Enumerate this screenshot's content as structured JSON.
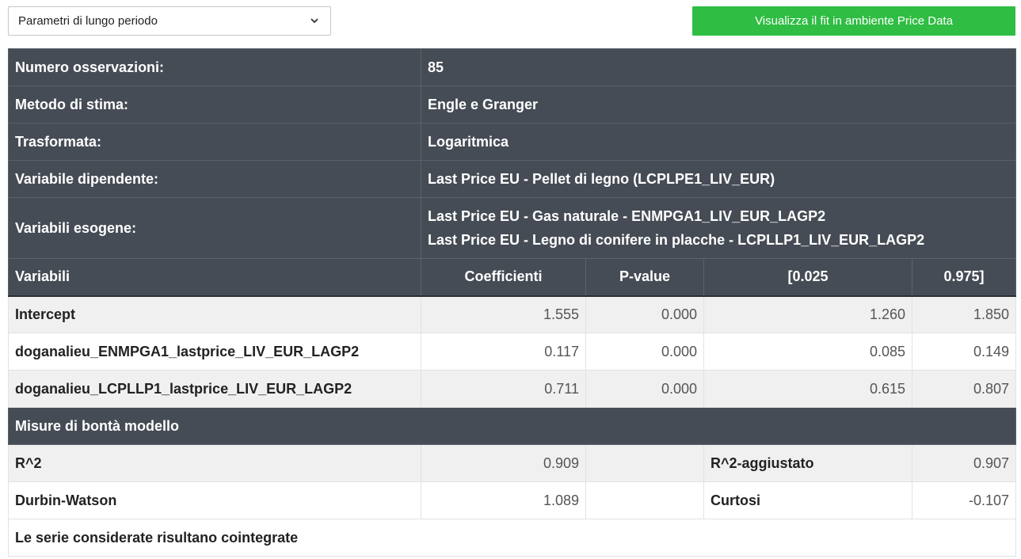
{
  "toolbar": {
    "select_value": "Parametri di lungo periodo",
    "fit_button_label": "Visualizza il fit in ambiente Price Data",
    "fit_button_color": "#2fbd43"
  },
  "info": {
    "observations_label": "Numero osservazioni:",
    "observations_value": "85",
    "method_label": "Metodo di stima:",
    "method_value": "Engle e Granger",
    "transform_label": "Trasformata:",
    "transform_value": "Logaritmica",
    "dependent_label": "Variabile dipendente:",
    "dependent_value": "Last Price EU - Pellet di legno (LCPLPE1_LIV_EUR)",
    "exogenous_label": "Variabili esogene:",
    "exogenous_values": [
      "Last Price EU - Gas naturale - ENMPGA1_LIV_EUR_LAGP2",
      "Last Price EU - Legno di conifere in placche - LCPLLP1_LIV_EUR_LAGP2"
    ]
  },
  "coef_table": {
    "headers": [
      "Variabili",
      "Coefficienti",
      "P-value",
      "[0.025",
      "0.975]"
    ],
    "rows": [
      [
        "Intercept",
        "1.555",
        "0.000",
        "1.260",
        "1.850"
      ],
      [
        "doganalieu_ENMPGA1_lastprice_LIV_EUR_LAGP2",
        "0.117",
        "0.000",
        "0.085",
        "0.149"
      ],
      [
        "doganalieu_LCPLLP1_lastprice_LIV_EUR_LAGP2",
        "0.711",
        "0.000",
        "0.615",
        "0.807"
      ]
    ]
  },
  "goodness": {
    "title": "Misure di bontà modello",
    "r2_label": "R^2",
    "r2_value": "0.909",
    "r2_adj_label": "R^2-aggiustato",
    "r2_adj_value": "0.907",
    "dw_label": "Durbin-Watson",
    "dw_value": "1.089",
    "kurtosis_label": "Curtosi",
    "kurtosis_value": "-0.107"
  },
  "conclusion": "Le serie considerate risultano cointegrate",
  "colors": {
    "header_bg": "#464c55",
    "row_gray": "#f0f0f0"
  }
}
